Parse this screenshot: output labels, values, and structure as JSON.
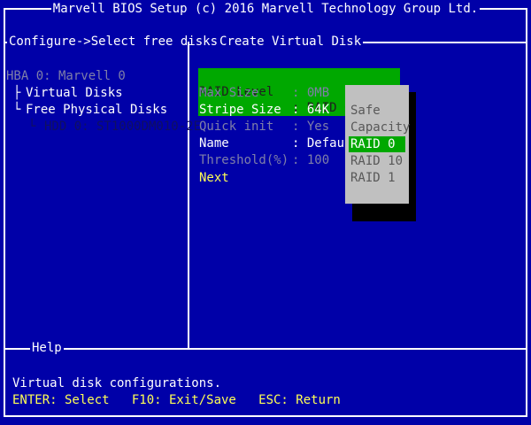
{
  "window": {
    "title": "Marvell BIOS Setup (c) 2016 Marvell Technology Group Ltd."
  },
  "breadcrumb": {
    "left": "Configure->Select free disks",
    "right": "Create Virtual Disk"
  },
  "tree": {
    "hba": "HBA 0: Marvell 0",
    "virtual_disks": "Virtual Disks",
    "free_disks": "Free Physical Disks",
    "hdd": "HDD 0: ST1000DM010-2E"
  },
  "form": {
    "raid_level": {
      "label": "RAID Level",
      "value": ": RAID 0"
    },
    "max_size": {
      "label": "Max Size",
      "value": ": 0MB"
    },
    "stripe_size": {
      "label": "Stripe Size",
      "value": ": 64K"
    },
    "quick_init": {
      "label": "Quick init",
      "value": ": Yes"
    },
    "name": {
      "label": "Name",
      "value": ": Defaul"
    },
    "threshold": {
      "label": "Threshold(%)",
      "value": ": 100"
    },
    "next": "Next"
  },
  "popup": {
    "options": [
      "Safe",
      "Capacity",
      "RAID 0",
      "RAID 10",
      "RAID 1"
    ],
    "selected_index": 2
  },
  "help": {
    "label": "Help",
    "text": "Virtual disk configurations.",
    "keys": "ENTER: Select   F10: Exit/Save   ESC: Return"
  },
  "colors": {
    "background": "#0000a8",
    "highlight": "#00a800",
    "popup": "#c0c0c0",
    "accent": "#ffff55"
  }
}
